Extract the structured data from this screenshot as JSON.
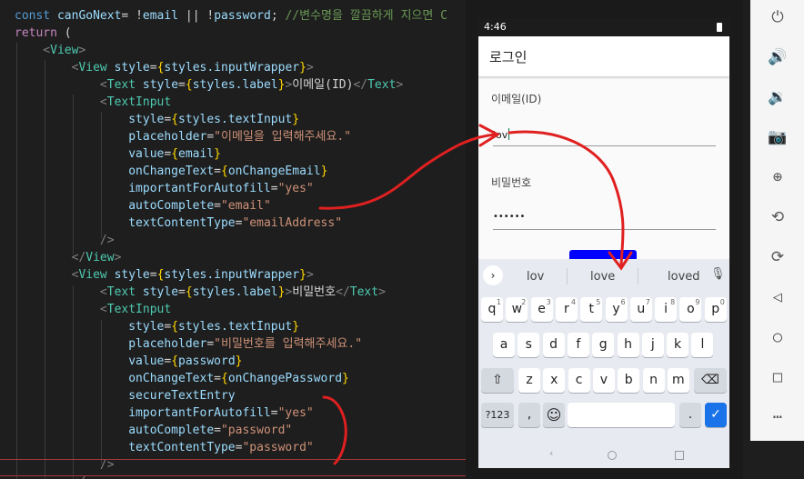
{
  "code": {
    "lines": [
      [
        [
          "kw",
          "const "
        ],
        [
          "var",
          "canGoNext"
        ],
        [
          "",
          "= "
        ],
        [
          "",
          "!"
        ],
        [
          "var",
          "email"
        ],
        [
          "",
          " || "
        ],
        [
          "",
          "!"
        ],
        [
          "var",
          "password"
        ],
        [
          "",
          "; "
        ],
        [
          "cmt",
          "//변수명을 깔끔하게 지으면 C"
        ]
      ],
      [
        [
          "ctl",
          "return"
        ],
        [
          "",
          " ("
        ]
      ],
      [
        [
          "br",
          "    <"
        ],
        [
          "tag",
          "View"
        ],
        [
          "br",
          ">"
        ]
      ],
      [
        [
          "br",
          "        <"
        ],
        [
          "tag",
          "View"
        ],
        [
          "attr",
          " style"
        ],
        [
          "",
          "="
        ],
        [
          "pun",
          "{"
        ],
        [
          "var",
          "styles.inputWrapper"
        ],
        [
          "pun",
          "}"
        ],
        [
          "br",
          ">"
        ]
      ],
      [
        [
          "br",
          "            <"
        ],
        [
          "tag",
          "Text"
        ],
        [
          "attr",
          " style"
        ],
        [
          "",
          "="
        ],
        [
          "pun",
          "{"
        ],
        [
          "var",
          "styles.label"
        ],
        [
          "pun",
          "}"
        ],
        [
          "br",
          ">"
        ],
        [
          "",
          "이메일(ID)"
        ],
        [
          "br",
          "</"
        ],
        [
          "tag",
          "Text"
        ],
        [
          "br",
          ">"
        ]
      ],
      [
        [
          "br",
          "            <"
        ],
        [
          "tag",
          "TextInput"
        ]
      ],
      [
        [
          "attr",
          "                style"
        ],
        [
          "",
          "="
        ],
        [
          "pun",
          "{"
        ],
        [
          "var",
          "styles.textInput"
        ],
        [
          "pun",
          "}"
        ]
      ],
      [
        [
          "attr",
          "                placeholder"
        ],
        [
          "",
          "="
        ],
        [
          "str",
          "\"이메일을 입력해주세요.\""
        ]
      ],
      [
        [
          "attr",
          "                value"
        ],
        [
          "",
          "="
        ],
        [
          "pun",
          "{"
        ],
        [
          "var",
          "email"
        ],
        [
          "pun",
          "}"
        ]
      ],
      [
        [
          "attr",
          "                onChangeText"
        ],
        [
          "",
          "="
        ],
        [
          "pun",
          "{"
        ],
        [
          "var",
          "onChangeEmail"
        ],
        [
          "pun",
          "}"
        ]
      ],
      [
        [
          "attr",
          "                importantForAutofill"
        ],
        [
          "",
          "="
        ],
        [
          "str",
          "\"yes\""
        ]
      ],
      [
        [
          "attr",
          "                autoComplete"
        ],
        [
          "",
          "="
        ],
        [
          "str",
          "\"email\""
        ]
      ],
      [
        [
          "attr",
          "                textContentType"
        ],
        [
          "",
          "="
        ],
        [
          "str",
          "\"emailAddress\""
        ]
      ],
      [
        [
          "br",
          "            />"
        ]
      ],
      [
        [
          "br",
          "        </"
        ],
        [
          "tag",
          "View"
        ],
        [
          "br",
          ">"
        ]
      ],
      [
        [
          "br",
          "        <"
        ],
        [
          "tag",
          "View"
        ],
        [
          "attr",
          " style"
        ],
        [
          "",
          "="
        ],
        [
          "pun",
          "{"
        ],
        [
          "var",
          "styles.inputWrapper"
        ],
        [
          "pun",
          "}"
        ],
        [
          "br",
          ">"
        ]
      ],
      [
        [
          "br",
          "            <"
        ],
        [
          "tag",
          "Text"
        ],
        [
          "attr",
          " style"
        ],
        [
          "",
          "="
        ],
        [
          "pun",
          "{"
        ],
        [
          "var",
          "styles.label"
        ],
        [
          "pun",
          "}"
        ],
        [
          "br",
          ">"
        ],
        [
          "",
          "비밀번호"
        ],
        [
          "br",
          "</"
        ],
        [
          "tag",
          "Text"
        ],
        [
          "br",
          ">"
        ]
      ],
      [
        [
          "br",
          "            <"
        ],
        [
          "tag",
          "TextInput"
        ]
      ],
      [
        [
          "attr",
          "                style"
        ],
        [
          "",
          "="
        ],
        [
          "pun",
          "{"
        ],
        [
          "var",
          "styles.textInput"
        ],
        [
          "pun",
          "}"
        ]
      ],
      [
        [
          "attr",
          "                placeholder"
        ],
        [
          "",
          "="
        ],
        [
          "str",
          "\"비밀번호를 입력해주세요.\""
        ]
      ],
      [
        [
          "attr",
          "                value"
        ],
        [
          "",
          "="
        ],
        [
          "pun",
          "{"
        ],
        [
          "var",
          "password"
        ],
        [
          "pun",
          "}"
        ]
      ],
      [
        [
          "attr",
          "                onChangeText"
        ],
        [
          "",
          "="
        ],
        [
          "pun",
          "{"
        ],
        [
          "var",
          "onChangePassword"
        ],
        [
          "pun",
          "}"
        ]
      ],
      [
        [
          "attr",
          "                secureTextEntry"
        ]
      ],
      [
        [
          "attr",
          "                importantForAutofill"
        ],
        [
          "",
          "="
        ],
        [
          "str",
          "\"yes\""
        ]
      ],
      [
        [
          "attr",
          "                autoComplete"
        ],
        [
          "",
          "="
        ],
        [
          "str",
          "\"password\""
        ]
      ],
      [
        [
          "attr",
          "                textContentType"
        ],
        [
          "",
          "="
        ],
        [
          "str",
          "\"password\""
        ]
      ],
      [
        [
          "br",
          "            />"
        ]
      ],
      [
        [
          "br",
          "        </"
        ]
      ]
    ]
  },
  "phone": {
    "status_time": "4:46",
    "appbar_title": "로그인",
    "email_label": "이메일(ID)",
    "email_value": "lov",
    "password_label": "비밀번호",
    "password_value": "••••••",
    "suggestions": [
      "lov",
      "love",
      "loved"
    ],
    "key_rows": [
      [
        "q",
        "w",
        "e",
        "r",
        "t",
        "y",
        "u",
        "i",
        "o",
        "p"
      ],
      [
        "a",
        "s",
        "d",
        "f",
        "g",
        "h",
        "j",
        "k",
        "l"
      ],
      [
        "z",
        "x",
        "c",
        "v",
        "b",
        "n",
        "m"
      ]
    ],
    "key_numbers": [
      "1",
      "2",
      "3",
      "4",
      "5",
      "6",
      "7",
      "8",
      "9",
      "0"
    ],
    "sym_key": "?123",
    "comma_key": ",",
    "period_key": ".",
    "shift_icon": "shift-icon",
    "backspace_icon": "backspace-icon",
    "enter_icon": "checkmark-icon"
  },
  "toolbar": {
    "icons": [
      "power-icon",
      "volume-up-icon",
      "volume-down-icon",
      "camera-icon",
      "zoom-icon",
      "rotate-left-icon",
      "rotate-right-icon",
      "back-icon",
      "home-icon",
      "overview-icon",
      "more-icon"
    ]
  },
  "colors": {
    "annotation": "#e02020",
    "submit_button": "#0000ff",
    "enter_key": "#1a73e8"
  }
}
